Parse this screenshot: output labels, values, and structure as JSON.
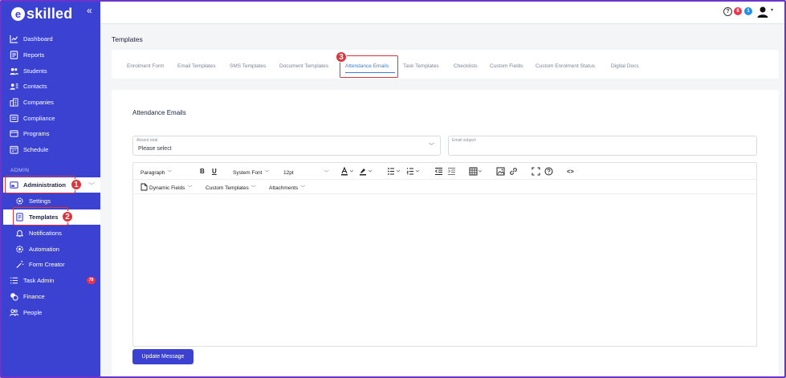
{
  "brand": {
    "logo_letter": "e",
    "logo_text": "skilled",
    "primary_color": "#3b42d1",
    "highlight_color": "#d9363e"
  },
  "sidebar": {
    "collapse_glyph": "«",
    "items": [
      {
        "label": "Dashboard",
        "icon": "chart-line-icon"
      },
      {
        "label": "Reports",
        "icon": "report-icon"
      },
      {
        "label": "Students",
        "icon": "users-icon"
      },
      {
        "label": "Contacts",
        "icon": "contact-card-icon"
      },
      {
        "label": "Companies",
        "icon": "building-icon"
      },
      {
        "label": "Compliance",
        "icon": "checklist-icon"
      },
      {
        "label": "Programs",
        "icon": "folder-icon"
      },
      {
        "label": "Schedule",
        "icon": "calendar-icon"
      }
    ],
    "section_admin": "ADMIN",
    "admin_item": {
      "label": "Administration",
      "icon": "admin-panel-icon",
      "step": "1"
    },
    "admin_subitems": [
      {
        "label": "Settings",
        "icon": "gear-icon"
      },
      {
        "label": "Templates",
        "icon": "document-icon",
        "step": "2"
      },
      {
        "label": "Notifications",
        "icon": "bell-icon"
      },
      {
        "label": "Automation",
        "icon": "automation-gear-icon"
      },
      {
        "label": "Form Creator",
        "icon": "magic-wand-icon"
      }
    ],
    "lower_items": [
      {
        "label": "Task Admin",
        "icon": "task-list-icon",
        "badge": "78"
      },
      {
        "label": "Finance",
        "icon": "coins-icon"
      },
      {
        "label": "People",
        "icon": "people-icon"
      }
    ]
  },
  "topbar": {
    "help_glyph": "?",
    "badge_red": "8",
    "badge_blue": "1",
    "caret": "▾"
  },
  "page": {
    "title": "Templates"
  },
  "tabs": [
    {
      "label": "Enrolment Form"
    },
    {
      "label": "Email Templates"
    },
    {
      "label": "SMS Templates"
    },
    {
      "label": "Document Templates"
    },
    {
      "label": "Attendance Emails",
      "active": true,
      "step": "3"
    },
    {
      "label": "Task Templates"
    },
    {
      "label": "Checklists"
    },
    {
      "label": "Custom Fields"
    },
    {
      "label": "Custom Enrolment Status"
    },
    {
      "label": "Digital Docs"
    }
  ],
  "form": {
    "card_title": "Attendance Emails",
    "absent_total": {
      "label": "Absent total",
      "value": "Please select"
    },
    "email_subject": {
      "label": "Email subject",
      "value": ""
    }
  },
  "editor": {
    "block_format": "Paragraph",
    "font_family": "System Font",
    "font_size": "12pt",
    "bold": "B",
    "underline": "U",
    "code": "<>",
    "dynamic_fields": "Dynamic Fields",
    "custom_templates": "Custom Templates",
    "attachments": "Attachments"
  },
  "actions": {
    "submit": "Update Message"
  }
}
